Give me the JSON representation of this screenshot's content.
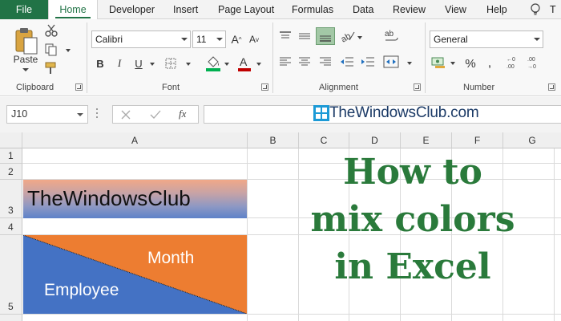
{
  "tabs": [
    "File",
    "Home",
    "Developer",
    "Insert",
    "Page Layout",
    "Formulas",
    "Data",
    "Review",
    "View",
    "Help",
    "T"
  ],
  "ribbon": {
    "clipboard": {
      "paste_label": "Paste",
      "group_label": "Clipboard"
    },
    "font": {
      "font_name": "Calibri",
      "font_size": "11",
      "group_label": "Font",
      "fill_color": "#00b050",
      "font_color": "#c00000"
    },
    "alignment": {
      "group_label": "Alignment"
    },
    "number": {
      "format": "General",
      "group_label": "Number"
    }
  },
  "formula_bar": {
    "name_box": "J10",
    "fx": "fx",
    "formula": ""
  },
  "watermark": {
    "text": "TheWindowsClub.com"
  },
  "grid": {
    "columns": [
      "A",
      "B",
      "C",
      "D",
      "E",
      "F",
      "G"
    ],
    "rows": [
      "1",
      "2",
      "3",
      "4",
      "5"
    ],
    "cells": {
      "a3": "TheWindowsClub",
      "a5_top": "Month",
      "a5_bottom": "Employee"
    },
    "colors": {
      "orange": "#ed7d31",
      "blue": "#4472c4",
      "title_green": "#2a7a3b"
    }
  },
  "overlay_title": [
    "How to",
    "mix colors",
    "in Excel"
  ]
}
